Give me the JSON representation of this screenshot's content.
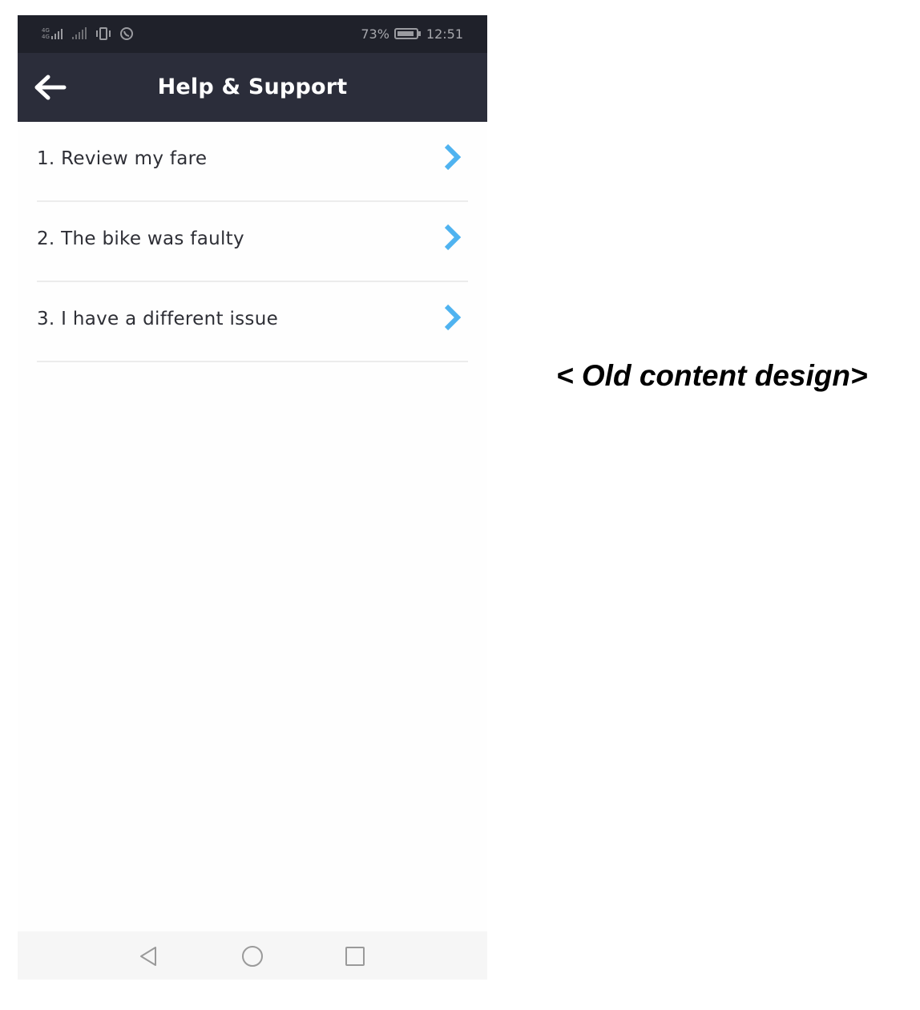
{
  "status_bar": {
    "battery_percent": "73%",
    "time": "12:51",
    "icons": [
      "signal-4g-icon",
      "signal-bars-icon",
      "vibrate-icon",
      "whatsapp-icon",
      "battery-icon"
    ]
  },
  "header": {
    "title": "Help & Support",
    "back_icon": "arrow-left-icon"
  },
  "menu": {
    "items": [
      {
        "label": "1. Review my fare",
        "icon": "chevron-right-icon"
      },
      {
        "label": "2. The bike was faulty",
        "icon": "chevron-right-icon"
      },
      {
        "label": "3. I have a different issue",
        "icon": "chevron-right-icon"
      }
    ]
  },
  "nav_bar": {
    "buttons": [
      "back-triangle-icon",
      "home-circle-icon",
      "recents-square-icon"
    ]
  },
  "caption": "< Old content design>",
  "colors": {
    "status_bar_bg": "#1f212a",
    "header_bg": "#2b2d3a",
    "chevron": "#4fb3f0",
    "divider": "#ececec"
  }
}
